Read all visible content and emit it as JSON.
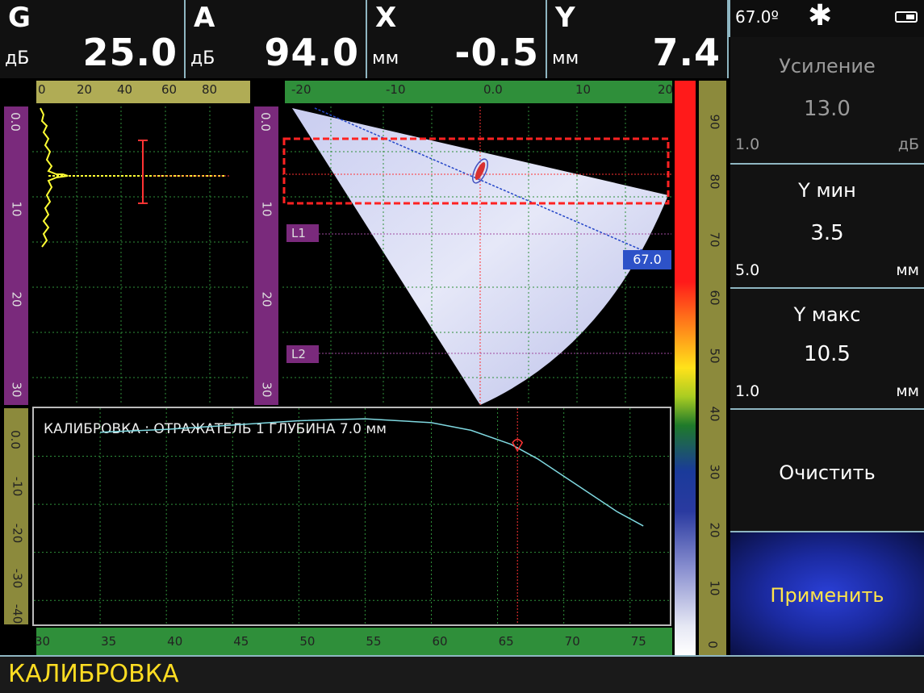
{
  "header": {
    "G": {
      "title": "G",
      "unit": "дБ",
      "value": "25.0"
    },
    "A": {
      "title": "A",
      "unit": "дБ",
      "value": "94.0"
    },
    "X": {
      "title": "X",
      "unit": "мм",
      "value": "-0.5"
    },
    "Y": {
      "title": "Y",
      "unit": "мм",
      "value": "7.4"
    }
  },
  "status": {
    "angle": "67.0º"
  },
  "params": [
    {
      "name": "Усиление",
      "value": "13.0",
      "step": "1.0",
      "unit": "дБ",
      "dimmed": true
    },
    {
      "name": "Y мин",
      "value": "3.5",
      "step": "5.0",
      "unit": "мм"
    },
    {
      "name": "Y макс",
      "value": "10.5",
      "step": "1.0",
      "unit": "мм"
    }
  ],
  "buttons": {
    "clear": "Очистить",
    "apply": "Применить"
  },
  "ascan_ruler": [
    "0",
    "20",
    "40",
    "60",
    "80"
  ],
  "depth_ruler": [
    "0.0",
    "10",
    "20",
    "30"
  ],
  "sector_ruler": [
    "-20",
    "-10",
    "0.0",
    "10",
    "20"
  ],
  "color_ruler": [
    "90",
    "80",
    "70",
    "60",
    "50",
    "40",
    "30",
    "20",
    "10",
    "0"
  ],
  "sector_labels": {
    "beam_angle": "67.0",
    "l1": "L1",
    "l2": "L2"
  },
  "calib": {
    "caption": "КАЛИБРОВКА : ОТРАЖАТЕЛЬ 1 ГЛУБИНА 7.0 мм",
    "y_ruler": [
      "0.0",
      "-10",
      "-20",
      "-30",
      "-40"
    ],
    "x_ruler": [
      "30",
      "35",
      "40",
      "45",
      "50",
      "55",
      "60",
      "65",
      "70",
      "75"
    ]
  },
  "chart_data": {
    "type": "line",
    "title": "КАЛИБРОВКА : ОТРАЖАТЕЛЬ 1 ГЛУБИНА 7.0 мм",
    "xlim": [
      30,
      78
    ],
    "ylim": [
      0,
      -45
    ],
    "series": [
      {
        "x": [
          35,
          40,
          45,
          50,
          55,
          60,
          63,
          66,
          68,
          71,
          74,
          76
        ],
        "y": [
          -5.0,
          -4.4,
          -3.5,
          -2.6,
          -2.2,
          -3.0,
          -4.6,
          -7.5,
          -10.5,
          -16.0,
          -21.5,
          -24.5
        ]
      }
    ],
    "marker": {
      "x": 66.5,
      "y": -7.5
    }
  },
  "bottom_status": "КАЛИБРОВКА",
  "colors": {
    "header_bg": "#111111",
    "border": "#8fb6c2",
    "ascan": "#ffff33",
    "cursor": "#ff2222",
    "grid": "#2f8f3a",
    "curve": "#7fd8e0",
    "status_text": "#ffdd22"
  }
}
